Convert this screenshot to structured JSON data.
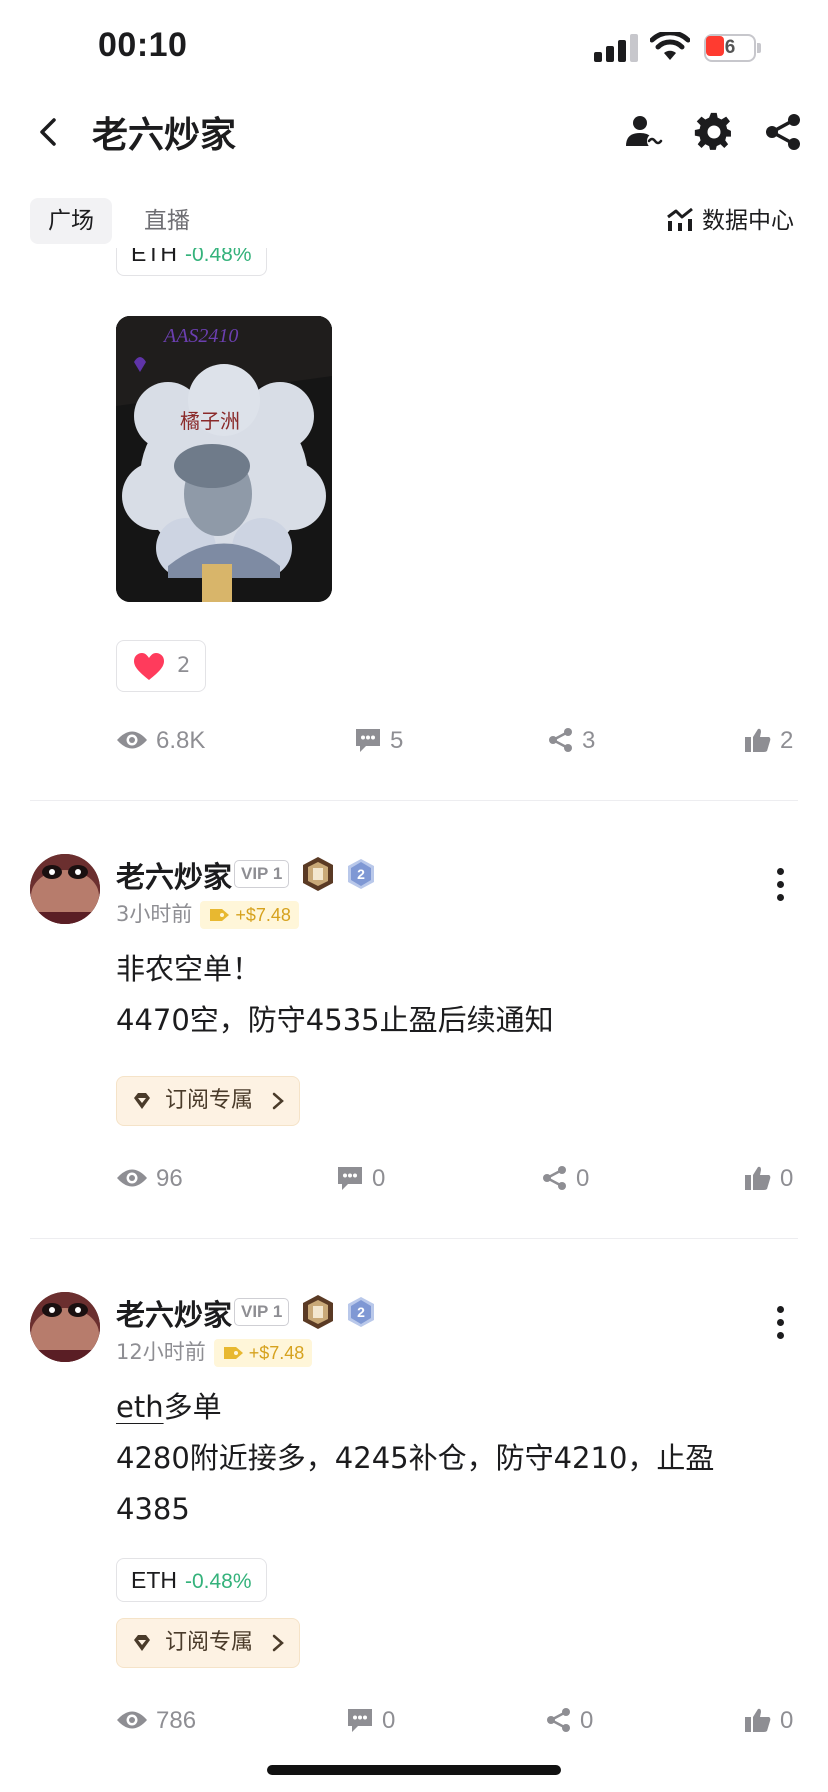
{
  "status_bar": {
    "time": "00:10",
    "battery_level": "6",
    "battery_icon": "battery-low-charging-icon"
  },
  "nav": {
    "title": "老六炒家",
    "icons": [
      "back-icon",
      "user-icon",
      "gear-icon",
      "share-icon"
    ]
  },
  "tabs": [
    {
      "label": "广场",
      "active": true
    },
    {
      "label": "直播",
      "active": false
    }
  ],
  "data_center_label": "数据中心",
  "colors": {
    "positive": "#34b27b",
    "pnl": "#d6a21e",
    "like": "#ff3b5c",
    "muted": "#8e8e93"
  },
  "post0": {
    "ticker": {
      "symbol": "ETH",
      "change": "-0.48%"
    },
    "image_caption": "橘子洲",
    "image_handwriting": "AAS2410",
    "reaction": {
      "icon": "heart-icon",
      "count": "2"
    },
    "stats": {
      "views": "6.8K",
      "comments": "5",
      "shares": "3",
      "likes": "2"
    }
  },
  "post1": {
    "author": "老六炒家",
    "vip": "VIP 1",
    "level": "2",
    "time_ago": "3小时前",
    "pnl": "+$7.48",
    "lines": [
      "非农空单！",
      "4470空，防守4535止盈后续通知"
    ],
    "subscribe_label": "订阅专属",
    "stats": {
      "views": "96",
      "comments": "0",
      "shares": "0",
      "likes": "0"
    }
  },
  "post2": {
    "author": "老六炒家",
    "vip": "VIP 1",
    "level": "2",
    "time_ago": "12小时前",
    "pnl": "+$7.48",
    "line1_prefix": "eth",
    "line1_suffix": "多单",
    "lines": [
      "4280附近接多，4245补仓，防守4210，止盈",
      "4385"
    ],
    "ticker": {
      "symbol": "ETH",
      "change": "-0.48%"
    },
    "subscribe_label": "订阅专属",
    "stats": {
      "views": "786",
      "comments": "0",
      "shares": "0",
      "likes": "0"
    }
  }
}
